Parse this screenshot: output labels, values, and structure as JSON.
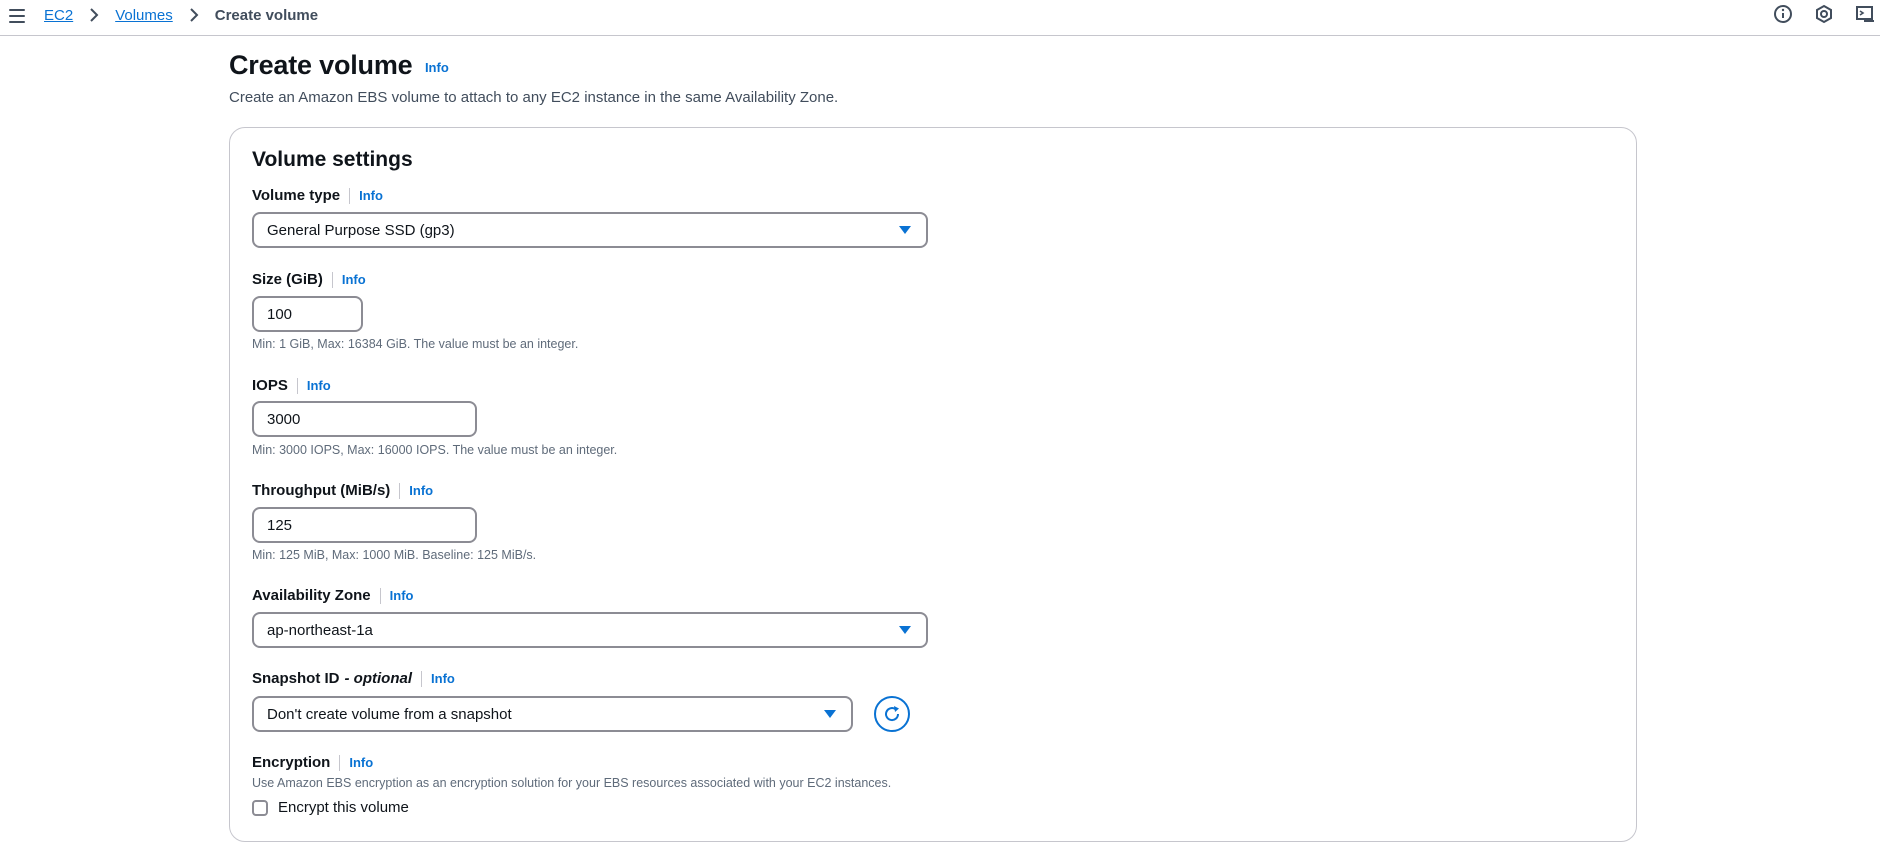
{
  "breadcrumb": {
    "items": [
      "EC2",
      "Volumes"
    ],
    "current": "Create volume"
  },
  "header": {
    "title": "Create volume",
    "info": "Info",
    "description": "Create an Amazon EBS volume to attach to any EC2 instance in the same Availability Zone."
  },
  "settings": {
    "title": "Volume settings",
    "info": "Info",
    "volume_type": {
      "label": "Volume type",
      "value": "General Purpose SSD (gp3)"
    },
    "size": {
      "label": "Size (GiB)",
      "value": "100",
      "hint": "Min: 1 GiB, Max: 16384 GiB. The value must be an integer."
    },
    "iops": {
      "label": "IOPS",
      "value": "3000",
      "hint": "Min: 3000 IOPS, Max: 16000 IOPS. The value must be an integer."
    },
    "throughput": {
      "label": "Throughput (MiB/s)",
      "value": "125",
      "hint": "Min: 125 MiB, Max: 1000 MiB. Baseline: 125 MiB/s."
    },
    "availability_zone": {
      "label": "Availability Zone",
      "value": "ap-northeast-1a"
    },
    "snapshot": {
      "label": "Snapshot ID",
      "optional": "- optional",
      "value": "Don't create volume from a snapshot"
    },
    "encryption": {
      "label": "Encryption",
      "description": "Use Amazon EBS encryption as an encryption solution for your EBS resources associated with your EC2 instances.",
      "checkbox_label": "Encrypt this volume",
      "checked": false
    }
  },
  "colors": {
    "link": "#0972d3",
    "text": "#0f141a",
    "secondary_text": "#414d5c",
    "border": "#8c8c94"
  },
  "icons": [
    "menu-icon",
    "chevron-right-icon",
    "info-circle-icon",
    "settings-hex-icon",
    "cloudshell-icon",
    "caret-down-icon",
    "refresh-icon"
  ]
}
